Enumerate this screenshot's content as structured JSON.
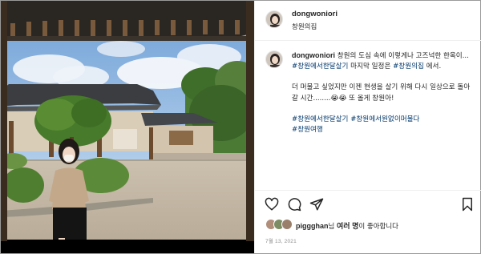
{
  "post": {
    "username": "dongwoniori",
    "location": "창원의집"
  },
  "caption": {
    "username": "dongwoniori",
    "line1_text": " 창원의 도심 속에 이렇게나 고즈넉한 한옥이...",
    "line2_tag": "#창원에서한달살기",
    "line2_text": " 마지막 일정은 ",
    "line2_tag2": "#창원의집",
    "line2_text2": " 에서.",
    "line3_text": "더 머물고 싶었지만 이젠 현생을 살기 위해 다시 일상으로 돌아갈 시간........😭😭 또 올게 창원아!",
    "tags_line1_a": "#창원에서한달살기",
    "tags_line1_b": "#창원에서원없이머물다",
    "tags_line2": "#창원여행"
  },
  "actions": {
    "like_icon": "heart-icon",
    "comment_icon": "comment-icon",
    "share_icon": "paper-plane-icon",
    "save_icon": "bookmark-icon"
  },
  "likes": {
    "first_user": "piggghan",
    "middle": "님 ",
    "others": "여러 명",
    "suffix": "이 좋아합니다"
  },
  "date": "7월 13, 2021",
  "colors": {
    "hashtag": "#00376b",
    "text": "#262626",
    "muted": "#8e8e8e",
    "divider": "#efefef"
  }
}
